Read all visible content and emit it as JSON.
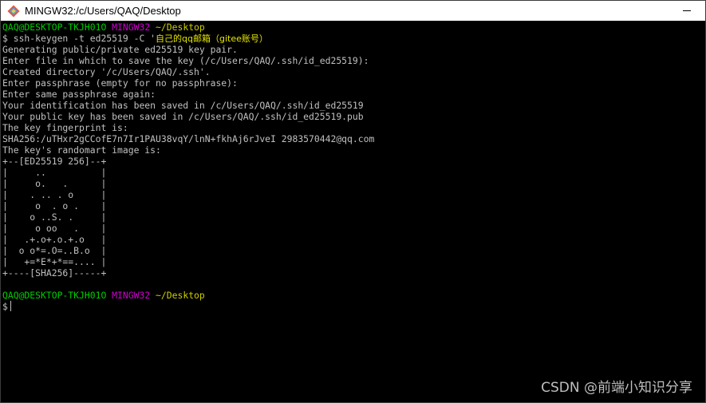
{
  "window": {
    "title": "MINGW32:/c/Users/QAQ/Desktop"
  },
  "prompt": {
    "user_host": "QAQ@DESKTOP-TKJH01O",
    "system": "MINGW32",
    "dir": "~/Desktop"
  },
  "command": {
    "prefix": "$ ssh-keygen -t ed25519 -C '",
    "highlight": "自己的qq邮箱（gitee账号）"
  },
  "output": [
    "Generating public/private ed25519 key pair.",
    "Enter file in which to save the key (/c/Users/QAQ/.ssh/id_ed25519):",
    "Created directory '/c/Users/QAQ/.ssh'.",
    "Enter passphrase (empty for no passphrase):",
    "Enter same passphrase again:",
    "Your identification has been saved in /c/Users/QAQ/.ssh/id_ed25519",
    "Your public key has been saved in /c/Users/QAQ/.ssh/id_ed25519.pub",
    "The key fingerprint is:",
    "SHA256:/uTHxr2gCCofE7n7Ir1PAU38vqY/lnN+fkhAj6rJveI 2983570442@qq.com",
    "The key's randomart image is:",
    "+--[ED25519 256]--+",
    "|     ..          |",
    "|     o.   .      |",
    "|    . .. . o     |",
    "|     o  . o .    |",
    "|    o ..S. .     |",
    "|     o oo   .    |",
    "|   .+.o+.o.+.o   |",
    "|  o o*=.O=..B.o  |",
    "|   +=*E*+*==.... |",
    "+----[SHA256]-----+"
  ],
  "second_prompt": {
    "user_host": "QAQ@DESKTOP-TKJH01O",
    "system": "MINGW32",
    "dir": "~/Desktop"
  },
  "input_line": {
    "symbol": "$"
  },
  "watermark": "CSDN @前端小知识分享",
  "colors": {
    "user": "#00cd00",
    "system": "#cd00cd",
    "dir": "#cdcd00",
    "text": "#c0c0c0",
    "background": "#000000"
  }
}
